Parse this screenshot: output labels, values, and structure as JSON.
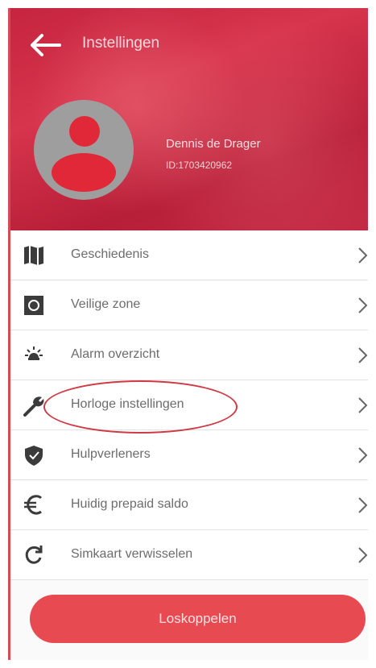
{
  "header": {
    "title": "Instellingen"
  },
  "user": {
    "name": "Dennis de Drager",
    "id": "ID:1703420962"
  },
  "menu": [
    {
      "label": "Geschiedenis",
      "icon": "map-icon"
    },
    {
      "label": "Veilige zone",
      "icon": "safe-zone-icon"
    },
    {
      "label": "Alarm overzicht",
      "icon": "alarm-icon"
    },
    {
      "label": "Horloge instellingen",
      "icon": "wrench-icon"
    },
    {
      "label": "Hulpverleners",
      "icon": "shield-icon"
    },
    {
      "label": "Huidig prepaid saldo",
      "icon": "euro-icon"
    },
    {
      "label": "Simkaart verwisselen",
      "icon": "refresh-icon"
    }
  ],
  "actions": {
    "unlink_label": "Loskoppelen"
  },
  "colors": {
    "header": "#c6253f",
    "accent": "#e84a52",
    "icon": "#3b3b3b",
    "text": "#6c6c6c"
  }
}
